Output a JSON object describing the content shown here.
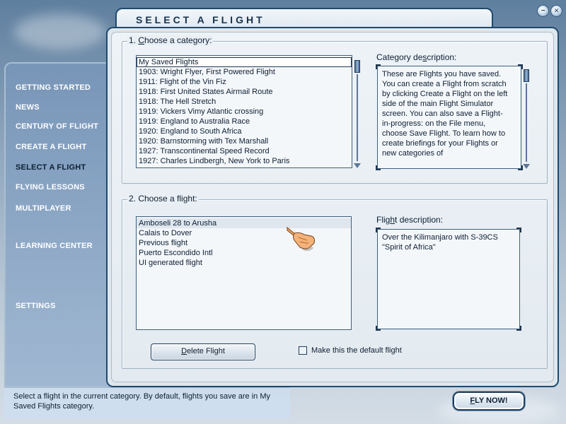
{
  "window": {
    "title": "SELECT A FLIGHT",
    "minimize_glyph": "−",
    "close_glyph": "✕"
  },
  "nav": {
    "items": [
      {
        "label": "GETTING STARTED"
      },
      {
        "label": "NEWS"
      },
      {
        "label": "CENTURY OF FLIGHT"
      },
      {
        "label": "CREATE A FLIGHT"
      },
      {
        "label": "SELECT A FLIGHT",
        "active": true
      },
      {
        "label": "FLYING LESSONS"
      },
      {
        "label": "MULTIPLAYER"
      },
      {
        "label": "LEARNING CENTER"
      },
      {
        "label": "SETTINGS"
      }
    ]
  },
  "category": {
    "section_label_pre": "1. ",
    "section_label_u": "C",
    "section_label_post": "hoose a category:",
    "items": [
      "My Saved Flights",
      "1903: Wright Flyer, First Powered Flight",
      "1911: Flight of the Vin Fiz",
      "1918: First United States Airmail Route",
      "1918: The Hell Stretch",
      "1919: Vickers Vimy Atlantic crossing",
      "1919: England to Australia Race",
      "1920: England to South Africa",
      "1920: Barnstorming with Tex Marshall",
      "1927: Transcontinental Speed Record",
      "1927: Charles Lindbergh, New York to Paris"
    ],
    "selected_index": 0,
    "description_label_pre": "Category de",
    "description_label_u": "s",
    "description_label_post": "cription:",
    "description": "These are Flights you have saved. You can create a Flight from scratch by clicking Create a Flight on the left side of the main Flight Simulator screen. You can also save a Flight-in-progress: on the File menu, choose Save Flight. To learn how to create briefings for your Flights or new categories of"
  },
  "flight": {
    "section_label_pre": "2. Choose a fli",
    "section_label_u": "g",
    "section_label_post": "ht:",
    "items": [
      "Amboseli 28 to Arusha",
      "Calais to Dover",
      "Previous flight",
      "Puerto Escondido Intl",
      "UI generated flight"
    ],
    "selected_index": 0,
    "description_label_pre": "Flig",
    "description_label_u": "h",
    "description_label_post": "t description:",
    "description": "Over the Kilimanjaro with S-39CS \"Spirit of Africa\""
  },
  "actions": {
    "delete_pre": "",
    "delete_u": "D",
    "delete_post": "elete Flight",
    "default_checkbox_label": "Make this the default flight",
    "default_checked": false,
    "fly_now_u": "F",
    "fly_now_post": "LY NOW!"
  },
  "status": {
    "text": "Select a flight in the current category. By default, flights you save are in My Saved Flights category."
  },
  "colors": {
    "accent_border": "#1e4a6e",
    "panel_bg": "#e3eaf0",
    "nav_text": "#ffffff",
    "nav_active_text": "#0d1f33"
  }
}
